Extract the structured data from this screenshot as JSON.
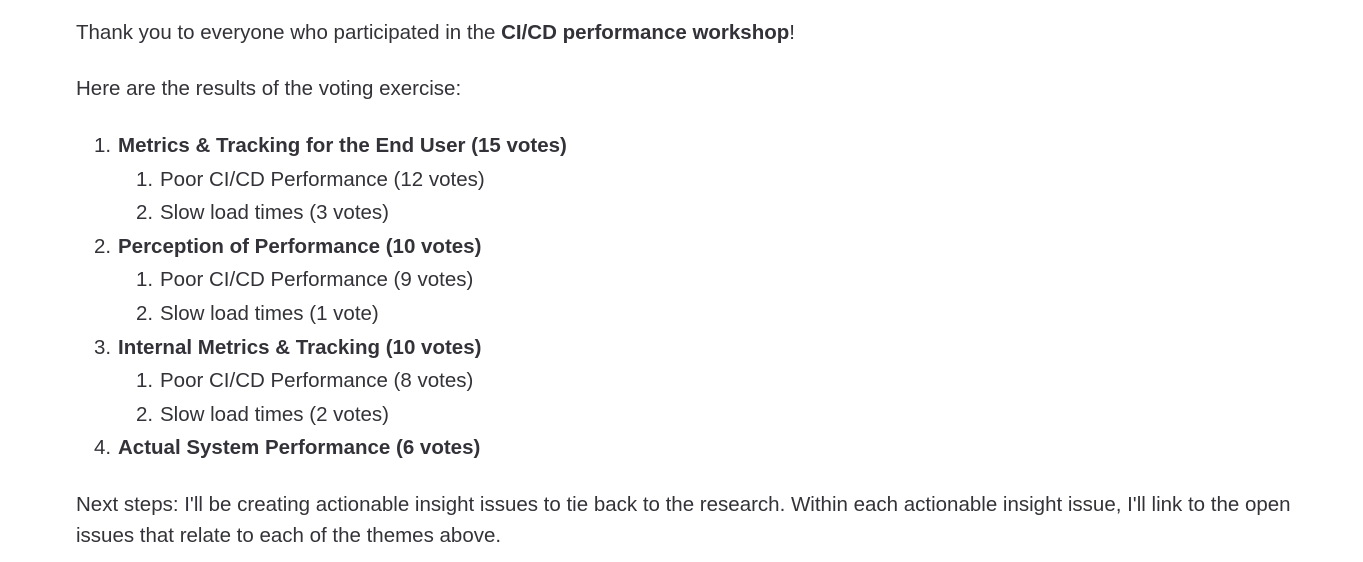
{
  "intro": {
    "prefix": "Thank you to everyone who participated in the ",
    "highlight": "CI/CD performance workshop",
    "suffix": "!"
  },
  "lead": "Here are the results of the voting exercise:",
  "topics": [
    {
      "label": "Metrics & Tracking for the End User (15 votes)",
      "sub": [
        "Poor CI/CD Performance (12 votes)",
        "Slow load times (3 votes)"
      ]
    },
    {
      "label": "Perception of Performance (10 votes)",
      "sub": [
        "Poor CI/CD Performance (9 votes)",
        "Slow load times (1 vote)"
      ]
    },
    {
      "label": "Internal Metrics & Tracking (10 votes)",
      "sub": [
        "Poor CI/CD Performance (8 votes)",
        "Slow load times (2 votes)"
      ]
    },
    {
      "label": "Actual System Performance (6 votes)",
      "sub": []
    }
  ],
  "next_steps": "Next steps: I'll be creating actionable insight issues to tie back to the research. Within each actionable insight issue, I'll link to the open issues that relate to each of the themes above."
}
